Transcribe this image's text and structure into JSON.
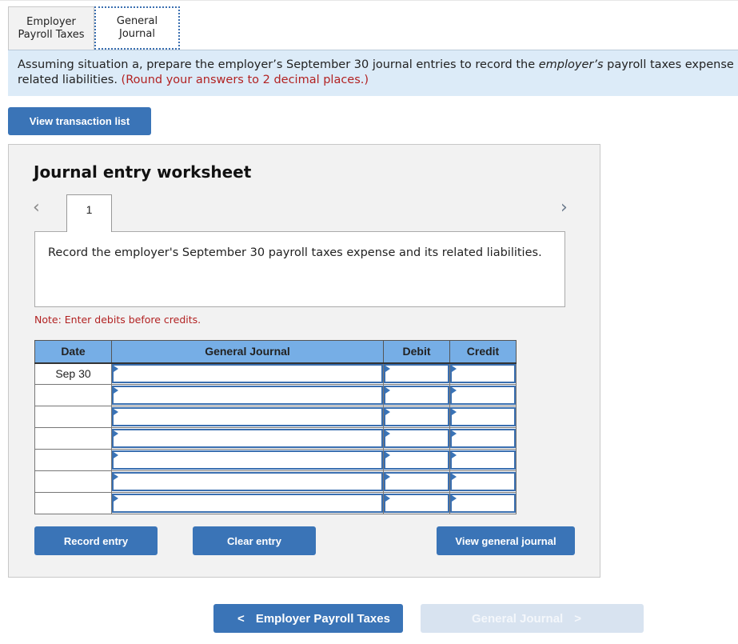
{
  "tabs": [
    {
      "label": "Employer Payroll Taxes",
      "line1": "Employer",
      "line2": "Payroll Taxes",
      "active": false
    },
    {
      "label": "General Journal",
      "line1": "General",
      "line2": "Journal",
      "active": true
    }
  ],
  "instructions": {
    "part1": "Assuming situation a, prepare the employer’s September 30 journal entries to record the ",
    "emphasis": "employer’s",
    "part2": " payroll taxes expense and its",
    "line2": "related liabilities. ",
    "round_note": "(Round your answers to 2 decimal places.)"
  },
  "buttons": {
    "view_transaction_list": "View transaction list",
    "record_entry": "Record entry",
    "clear_entry": "Clear entry",
    "view_general_journal": "View general journal"
  },
  "worksheet": {
    "title": "Journal entry worksheet",
    "prev_icon": "‹",
    "next_icon": "›",
    "current_step": "1",
    "description": "Record the employer's September 30 payroll taxes expense and its related liabilities.",
    "note": "Note: Enter debits before credits."
  },
  "table": {
    "headers": [
      "Date",
      "General Journal",
      "Debit",
      "Credit"
    ],
    "rows": [
      {
        "date": "Sep 30",
        "account": "",
        "debit": "",
        "credit": ""
      },
      {
        "date": "",
        "account": "",
        "debit": "",
        "credit": ""
      },
      {
        "date": "",
        "account": "",
        "debit": "",
        "credit": ""
      },
      {
        "date": "",
        "account": "",
        "debit": "",
        "credit": ""
      },
      {
        "date": "",
        "account": "",
        "debit": "",
        "credit": ""
      },
      {
        "date": "",
        "account": "",
        "debit": "",
        "credit": ""
      },
      {
        "date": "",
        "account": "",
        "debit": "",
        "credit": ""
      }
    ]
  },
  "bottom_nav": {
    "back_label": "Employer Payroll Taxes",
    "back_icon": "<",
    "forward_label": "General Journal",
    "forward_icon": ">"
  },
  "colors": {
    "accent": "#3a74b7",
    "header_blue": "#76aee6",
    "instruction_bg": "#dcebf8",
    "note_red": "#b22222",
    "disabled_button": "#d8e3f0"
  }
}
